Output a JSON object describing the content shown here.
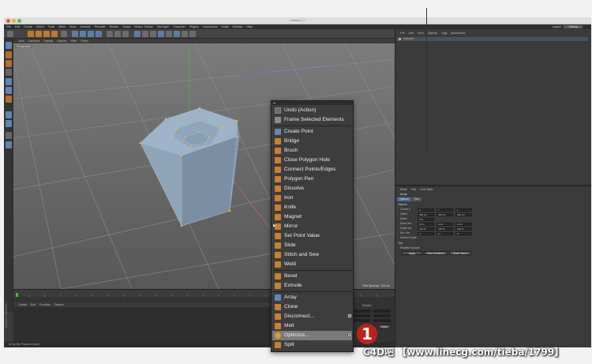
{
  "window": {
    "title": "Untitled 1 *"
  },
  "menubar": [
    "File",
    "Edit",
    "Create",
    "Select",
    "Tools",
    "Mesh",
    "Snap",
    "Animate",
    "Simulate",
    "Render",
    "Sculpt",
    "Motion Tracker",
    "MoGraph",
    "Character",
    "Plugins",
    "Lanzzaraus",
    "Script",
    "Window",
    "Help"
  ],
  "layout": {
    "label": "Layout:",
    "value": "Startup"
  },
  "viewport": {
    "menu": [
      "View",
      "Cameras",
      "Display",
      "Options",
      "Filter",
      "Panel"
    ],
    "label": "Perspective",
    "grid_info": "Grid Spacing : 100 cm"
  },
  "bottom_menu": [
    "Create",
    "Edit",
    "Function",
    "Texture"
  ],
  "coords": {
    "header": "Rotation",
    "apply": "Apply"
  },
  "status": "Array [No Params Input]",
  "side_logo": "MAXON CINEMA4D",
  "object_manager": {
    "menu": [
      "File",
      "Edit",
      "View",
      "Objects",
      "Tags",
      "Bookmarks"
    ],
    "object_name": "Cylinder"
  },
  "attributes": {
    "menu": [
      "Mode",
      "Edit",
      "User Data"
    ],
    "title": "Array",
    "tabs": [
      "Options",
      "Tool"
    ],
    "section_options": "Options",
    "rows": [
      {
        "label": "Clones X",
        "v1": "2",
        "v2": "1",
        "v3": "1"
      },
      {
        "label": "Offset",
        "v1": "300 cm",
        "v2": "300 cm",
        "v3": "300 cm"
      },
      {
        "label": "Noise",
        "v1": "0 %"
      },
      {
        "label": "Move Var.",
        "v1": "0 cm",
        "v2": "0 cm",
        "v3": "0 cm"
      },
      {
        "label": "Scale Var.",
        "v1": "100 %",
        "v2": "100 %",
        "v3": "100 %"
      },
      {
        "label": "Rot. Var.",
        "v1": "0 °",
        "v2": "0 °",
        "v3": "0 °"
      }
    ],
    "uniform_scale": "Uniform Scale",
    "section_tool": "Tool",
    "realtime_update": "Realtime Update",
    "buttons": [
      "Apply",
      "New Transform",
      "Reset Values"
    ]
  },
  "context_menu": {
    "items": [
      {
        "label": "Undo (Action)",
        "icon": "undo-icon",
        "kind": "undo"
      },
      {
        "label": "Frame Selected Elements",
        "icon": "frame-icon",
        "kind": "g"
      },
      {
        "sep": true
      },
      {
        "label": "Create Point",
        "icon": "create-point-icon",
        "kind": "b"
      },
      {
        "label": "Bridge",
        "icon": "bridge-icon",
        "kind": "o"
      },
      {
        "label": "Brush",
        "icon": "brush-icon",
        "kind": "o"
      },
      {
        "label": "Close Polygon Hole",
        "icon": "close-hole-icon",
        "kind": "o"
      },
      {
        "label": "Connect Points/Edges",
        "icon": "connect-icon",
        "kind": "o"
      },
      {
        "label": "Polygon Pen",
        "icon": "polygon-pen-icon",
        "kind": "o"
      },
      {
        "label": "Dissolve",
        "icon": "dissolve-icon",
        "kind": "o"
      },
      {
        "label": "Iron",
        "icon": "iron-icon",
        "kind": "o"
      },
      {
        "label": "Knife",
        "icon": "knife-icon",
        "kind": "o"
      },
      {
        "label": "Magnet",
        "icon": "magnet-icon",
        "kind": "o"
      },
      {
        "label": "Mirror",
        "icon": "mirror-icon",
        "kind": "o",
        "arrow": true
      },
      {
        "label": "Set Point Value",
        "icon": "set-point-icon",
        "kind": "o"
      },
      {
        "label": "Slide",
        "icon": "slide-icon",
        "kind": "o"
      },
      {
        "label": "Stitch and Sew",
        "icon": "stitch-icon",
        "kind": "o"
      },
      {
        "label": "Weld",
        "icon": "weld-icon",
        "kind": "o"
      },
      {
        "sep": true
      },
      {
        "label": "Bevel",
        "icon": "bevel-icon",
        "kind": "o"
      },
      {
        "label": "Extrude",
        "icon": "extrude-icon",
        "kind": "o"
      },
      {
        "sep": true
      },
      {
        "label": "Array",
        "icon": "array-icon",
        "kind": "b"
      },
      {
        "label": "Clone",
        "icon": "clone-icon",
        "kind": "o"
      },
      {
        "label": "Disconnect...",
        "icon": "disconnect-icon",
        "kind": "o",
        "gear": true
      },
      {
        "label": "Melt",
        "icon": "melt-icon",
        "kind": "o"
      },
      {
        "label": "Optimize...",
        "icon": "optimize-icon",
        "kind": "optimize",
        "gear": true,
        "highlight": true
      },
      {
        "label": "Split",
        "icon": "split-icon",
        "kind": "o"
      }
    ]
  },
  "annotation": {
    "number": "1"
  },
  "watermark": "C4D吧 【www.linecg.com/tieba/1799】",
  "colors": {
    "accent_blue": "#4a6d97",
    "tool_orange": "#c9812f",
    "badge_red": "#c0211a"
  }
}
